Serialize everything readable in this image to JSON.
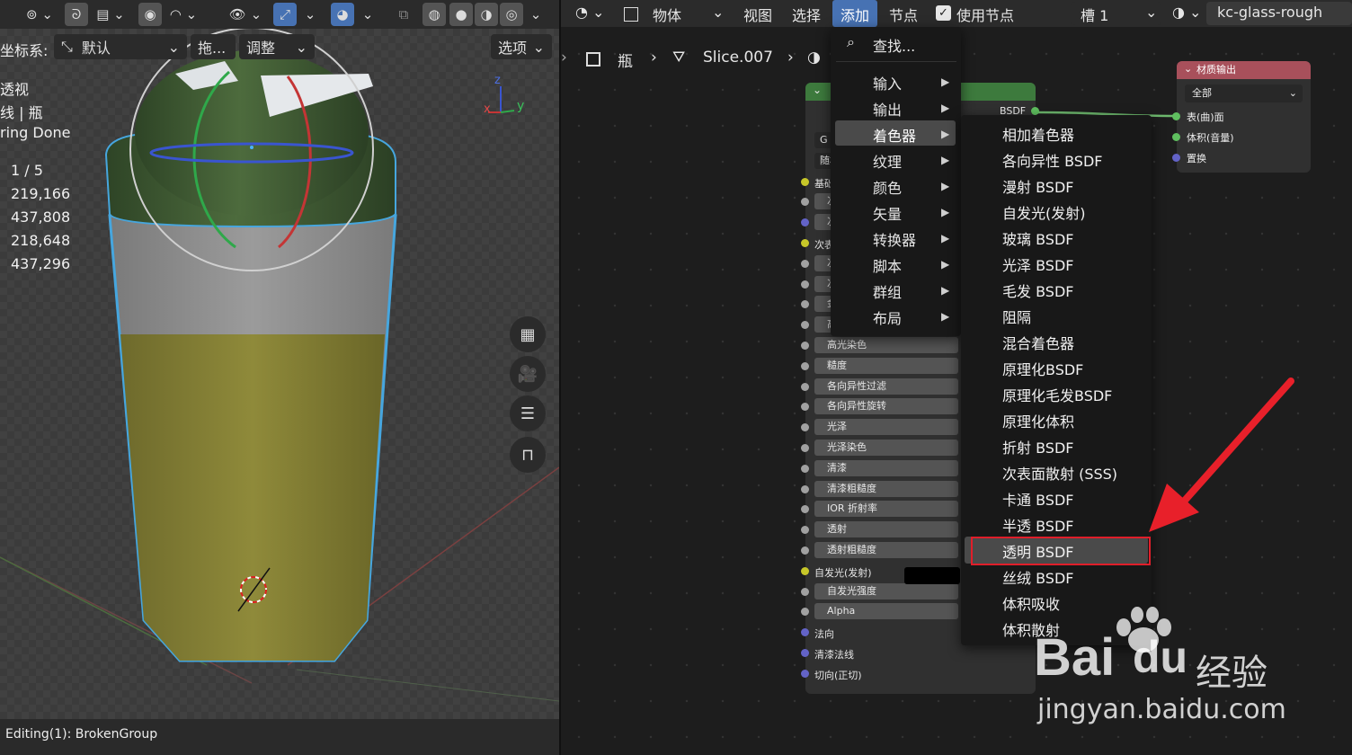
{
  "viewport": {
    "header": {
      "active_icon": "proportional-edit-icon"
    },
    "coord_label": "坐标系:",
    "coord_value": "默认",
    "drag_label": "拖...",
    "adjust_label": "调整",
    "options_label": "选项",
    "stats": {
      "view": "透视",
      "object": "线 | 瓶",
      "render": "ring Done",
      "objects": "1 / 5",
      "vertices": "219,166",
      "edges": "437,808",
      "faces": "218,648",
      "triangles": "437,296"
    },
    "axis_labels": {
      "x": "x",
      "y": "y",
      "z": "z"
    },
    "status": "Editing(1): BrokenGroup"
  },
  "node_editor": {
    "header": {
      "object_label": "物体",
      "view": "视图",
      "select": "选择",
      "add": "添加",
      "node": "节点",
      "use_nodes": "使用节点",
      "slot": "槽 1",
      "material": "kc-glass-rough"
    },
    "breadcrumb": {
      "object": "瓶",
      "mesh": "Slice.007",
      "material": "kc-glass-rough"
    },
    "bsdf_node": {
      "output_label": "BSDF",
      "rows": [
        {
          "label": "G",
          "kind": "dd"
        },
        {
          "label": "随机游走",
          "kind": "dd"
        },
        {
          "label": "基础色",
          "kind": "label",
          "socket": "y"
        },
        {
          "label": "次表面",
          "kind": "field",
          "socket": "g"
        },
        {
          "label": "次表面半径",
          "kind": "field",
          "socket": "p"
        },
        {
          "label": "次表面颜色",
          "kind": "label",
          "socket": "y"
        },
        {
          "label": "次表面IOR",
          "kind": "field",
          "socket": "g"
        },
        {
          "label": "次表面各向",
          "kind": "field",
          "socket": "g"
        },
        {
          "label": "金属度",
          "kind": "field",
          "socket": "g"
        },
        {
          "label": "高光",
          "kind": "field",
          "socket": "g"
        },
        {
          "label": "高光染色",
          "kind": "field",
          "socket": "g"
        },
        {
          "label": "糙度",
          "kind": "field",
          "socket": "g"
        },
        {
          "label": "各向异性过滤",
          "kind": "field",
          "socket": "g"
        },
        {
          "label": "各向异性旋转",
          "kind": "field",
          "socket": "g"
        },
        {
          "label": "光泽",
          "kind": "field",
          "socket": "g"
        },
        {
          "label": "光泽染色",
          "kind": "field",
          "socket": "g"
        },
        {
          "label": "清漆",
          "kind": "field",
          "socket": "g"
        },
        {
          "label": "清漆粗糙度",
          "kind": "field",
          "socket": "g"
        },
        {
          "label": "IOR 折射率",
          "kind": "field",
          "socket": "g"
        },
        {
          "label": "透射",
          "kind": "field",
          "socket": "g"
        },
        {
          "label": "透射粗糙度",
          "kind": "field",
          "socket": "g"
        },
        {
          "label": "自发光(发射)",
          "kind": "label",
          "socket": "y"
        },
        {
          "label": "自发光强度",
          "kind": "field",
          "socket": "g"
        },
        {
          "label": "Alpha",
          "kind": "field",
          "socket": "g"
        },
        {
          "label": "法向",
          "kind": "label",
          "socket": "p"
        },
        {
          "label": "清漆法线",
          "kind": "label",
          "socket": "p"
        },
        {
          "label": "切向(正切)",
          "kind": "label",
          "socket": "p"
        }
      ]
    },
    "material_output": {
      "title": "材质输出",
      "target": "全部",
      "inputs": [
        "表(曲)面",
        "体积(音量)",
        "置换"
      ]
    },
    "add_menu": {
      "search": "查找...",
      "items": [
        "输入",
        "输出",
        "着色器",
        "纹理",
        "颜色",
        "矢量",
        "转换器",
        "脚本",
        "群组",
        "布局"
      ],
      "highlighted": "着色器"
    },
    "shader_menu": {
      "items": [
        "相加着色器",
        "各向异性 BSDF",
        "漫射 BSDF",
        "自发光(发射)",
        "玻璃 BSDF",
        "光泽 BSDF",
        "毛发 BSDF",
        "阻隔",
        "混合着色器",
        "原理化BSDF",
        "原理化毛发BSDF",
        "原理化体积",
        "折射 BSDF",
        "次表面散射 (SSS)",
        "卡通 BSDF",
        "半透 BSDF",
        "透明 BSDF",
        "丝绒 BSDF",
        "体积吸收",
        "体积散射"
      ],
      "highlighted": "透明 BSDF"
    }
  },
  "watermark": {
    "brand": "Bai",
    "brand2": "du",
    "cn": "经验",
    "url": "jingyan.baidu.com"
  },
  "colors": {
    "accent": "#4772b3",
    "node_green": "#3d7a3d",
    "output_red": "#a8505b",
    "highlight_box": "#e01e2a",
    "arrow": "#e8202a"
  }
}
